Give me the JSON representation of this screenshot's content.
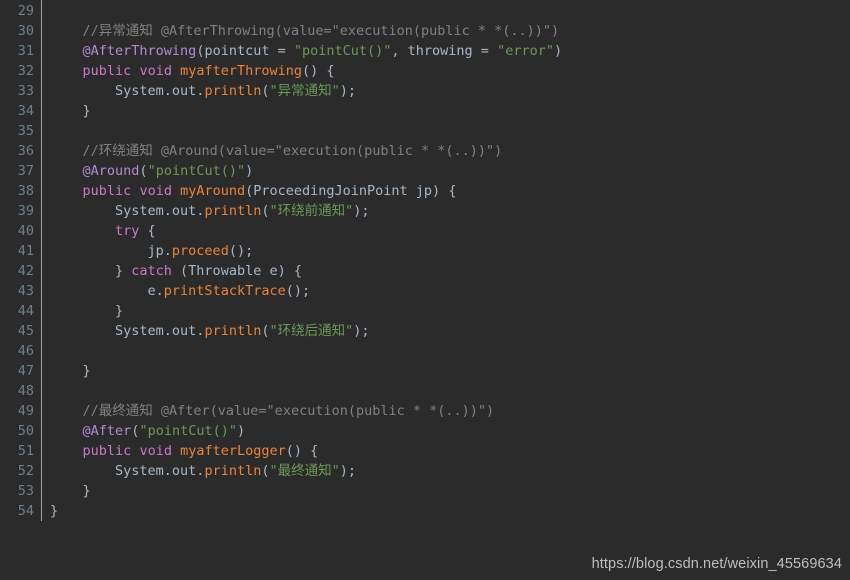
{
  "editor": {
    "theme_name": "darcula",
    "background_color": "#2b2b2b",
    "gutter_text_color": "#6d7f8a",
    "first_line_number": 29,
    "last_line_number": 54,
    "colors": {
      "plain": "#a9b7c6",
      "comment": "#808080",
      "keyword": "#cc78c8",
      "annotation": "#b389d4",
      "string": "#6a9955",
      "method": "#e8843c"
    },
    "lines": [
      {
        "number": "29",
        "tokens": []
      },
      {
        "number": "30",
        "tokens": [
          {
            "t": "    ",
            "c": "plain"
          },
          {
            "t": "//异常通知 @AfterThrowing(value=\"execution(public * *(..))\")",
            "c": "comment"
          }
        ]
      },
      {
        "number": "31",
        "tokens": [
          {
            "t": "    ",
            "c": "plain"
          },
          {
            "t": "@AfterThrowing",
            "c": "anno"
          },
          {
            "t": "(pointcut = ",
            "c": "plain"
          },
          {
            "t": "\"pointCut()\"",
            "c": "string"
          },
          {
            "t": ", throwing = ",
            "c": "plain"
          },
          {
            "t": "\"error\"",
            "c": "string"
          },
          {
            "t": ")",
            "c": "plain"
          }
        ]
      },
      {
        "number": "32",
        "tokens": [
          {
            "t": "    ",
            "c": "plain"
          },
          {
            "t": "public",
            "c": "keyword"
          },
          {
            "t": " ",
            "c": "plain"
          },
          {
            "t": "void",
            "c": "keyword"
          },
          {
            "t": " ",
            "c": "plain"
          },
          {
            "t": "myafterThrowing",
            "c": "method"
          },
          {
            "t": "() {",
            "c": "plain"
          }
        ]
      },
      {
        "number": "33",
        "tokens": [
          {
            "t": "        System.out.",
            "c": "plain"
          },
          {
            "t": "println",
            "c": "method"
          },
          {
            "t": "(",
            "c": "plain"
          },
          {
            "t": "\"异常通知\"",
            "c": "string"
          },
          {
            "t": ");",
            "c": "plain"
          }
        ]
      },
      {
        "number": "34",
        "tokens": [
          {
            "t": "    }",
            "c": "plain"
          }
        ]
      },
      {
        "number": "35",
        "tokens": []
      },
      {
        "number": "36",
        "tokens": [
          {
            "t": "    ",
            "c": "plain"
          },
          {
            "t": "//环绕通知 @Around(value=\"execution(public * *(..))\")",
            "c": "comment"
          }
        ]
      },
      {
        "number": "37",
        "tokens": [
          {
            "t": "    ",
            "c": "plain"
          },
          {
            "t": "@Around",
            "c": "anno"
          },
          {
            "t": "(",
            "c": "plain"
          },
          {
            "t": "\"pointCut()\"",
            "c": "string"
          },
          {
            "t": ")",
            "c": "plain"
          }
        ]
      },
      {
        "number": "38",
        "tokens": [
          {
            "t": "    ",
            "c": "plain"
          },
          {
            "t": "public",
            "c": "keyword"
          },
          {
            "t": " ",
            "c": "plain"
          },
          {
            "t": "void",
            "c": "keyword"
          },
          {
            "t": " ",
            "c": "plain"
          },
          {
            "t": "myAround",
            "c": "method"
          },
          {
            "t": "(ProceedingJoinPoint jp) {",
            "c": "plain"
          }
        ]
      },
      {
        "number": "39",
        "tokens": [
          {
            "t": "        System.out.",
            "c": "plain"
          },
          {
            "t": "println",
            "c": "method"
          },
          {
            "t": "(",
            "c": "plain"
          },
          {
            "t": "\"环绕前通知\"",
            "c": "string"
          },
          {
            "t": ");",
            "c": "plain"
          }
        ]
      },
      {
        "number": "40",
        "tokens": [
          {
            "t": "        ",
            "c": "plain"
          },
          {
            "t": "try",
            "c": "keyword"
          },
          {
            "t": " {",
            "c": "plain"
          }
        ]
      },
      {
        "number": "41",
        "tokens": [
          {
            "t": "            jp.",
            "c": "plain"
          },
          {
            "t": "proceed",
            "c": "method"
          },
          {
            "t": "();",
            "c": "plain"
          }
        ]
      },
      {
        "number": "42",
        "tokens": [
          {
            "t": "        } ",
            "c": "plain"
          },
          {
            "t": "catch",
            "c": "keyword"
          },
          {
            "t": " (Throwable e) {",
            "c": "plain"
          }
        ]
      },
      {
        "number": "43",
        "tokens": [
          {
            "t": "            e.",
            "c": "plain"
          },
          {
            "t": "printStackTrace",
            "c": "method"
          },
          {
            "t": "();",
            "c": "plain"
          }
        ]
      },
      {
        "number": "44",
        "tokens": [
          {
            "t": "        }",
            "c": "plain"
          }
        ]
      },
      {
        "number": "45",
        "tokens": [
          {
            "t": "        System.out.",
            "c": "plain"
          },
          {
            "t": "println",
            "c": "method"
          },
          {
            "t": "(",
            "c": "plain"
          },
          {
            "t": "\"环绕后通知\"",
            "c": "string"
          },
          {
            "t": ");",
            "c": "plain"
          }
        ]
      },
      {
        "number": "46",
        "tokens": []
      },
      {
        "number": "47",
        "tokens": [
          {
            "t": "    }",
            "c": "plain"
          }
        ]
      },
      {
        "number": "48",
        "tokens": []
      },
      {
        "number": "49",
        "tokens": [
          {
            "t": "    ",
            "c": "plain"
          },
          {
            "t": "//最终通知 @After(value=\"execution(public * *(..))\")",
            "c": "comment"
          }
        ]
      },
      {
        "number": "50",
        "tokens": [
          {
            "t": "    ",
            "c": "plain"
          },
          {
            "t": "@After",
            "c": "anno"
          },
          {
            "t": "(",
            "c": "plain"
          },
          {
            "t": "\"pointCut()\"",
            "c": "string"
          },
          {
            "t": ")",
            "c": "plain"
          }
        ]
      },
      {
        "number": "51",
        "tokens": [
          {
            "t": "    ",
            "c": "plain"
          },
          {
            "t": "public",
            "c": "keyword"
          },
          {
            "t": " ",
            "c": "plain"
          },
          {
            "t": "void",
            "c": "keyword"
          },
          {
            "t": " ",
            "c": "plain"
          },
          {
            "t": "myafterLogger",
            "c": "method"
          },
          {
            "t": "() {",
            "c": "plain"
          }
        ]
      },
      {
        "number": "52",
        "tokens": [
          {
            "t": "        System.out.",
            "c": "plain"
          },
          {
            "t": "println",
            "c": "method"
          },
          {
            "t": "(",
            "c": "plain"
          },
          {
            "t": "\"最终通知\"",
            "c": "string"
          },
          {
            "t": ");",
            "c": "plain"
          }
        ]
      },
      {
        "number": "53",
        "tokens": [
          {
            "t": "    }",
            "c": "plain"
          }
        ]
      },
      {
        "number": "54",
        "tokens": [
          {
            "t": "}",
            "c": "plain"
          }
        ]
      }
    ]
  },
  "watermark": {
    "text": "https://blog.csdn.net/weixin_45569634"
  }
}
